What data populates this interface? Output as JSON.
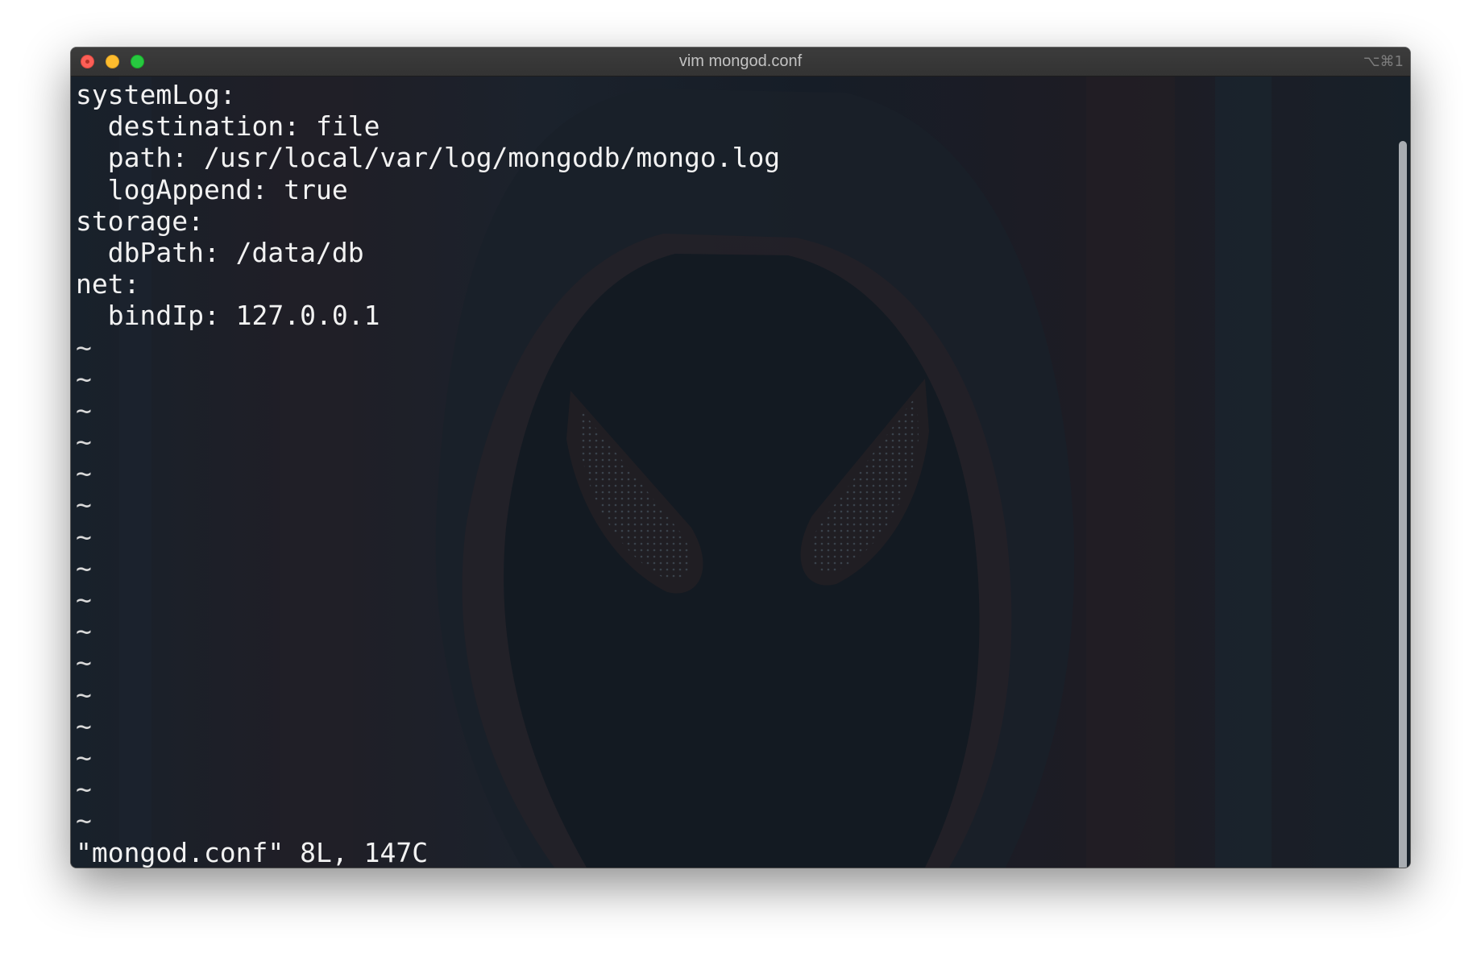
{
  "window": {
    "title": "vim mongod.conf",
    "shortcut": "⌥⌘1"
  },
  "editor": {
    "lines": [
      "systemLog:",
      "  destination: file",
      "  path: /usr/local/var/log/mongodb/mongo.log",
      "  logAppend: true",
      "storage:",
      "  dbPath: /data/db",
      "net:",
      "  bindIp: 127.0.0.1"
    ],
    "tilde": "~",
    "status": "\"mongod.conf\" 8L, 147C"
  },
  "colors": {
    "text": "#f2f2f2",
    "background": "#141a22",
    "close": "#fc5f57",
    "minimize": "#fdbc2e",
    "maximize": "#27c840"
  }
}
